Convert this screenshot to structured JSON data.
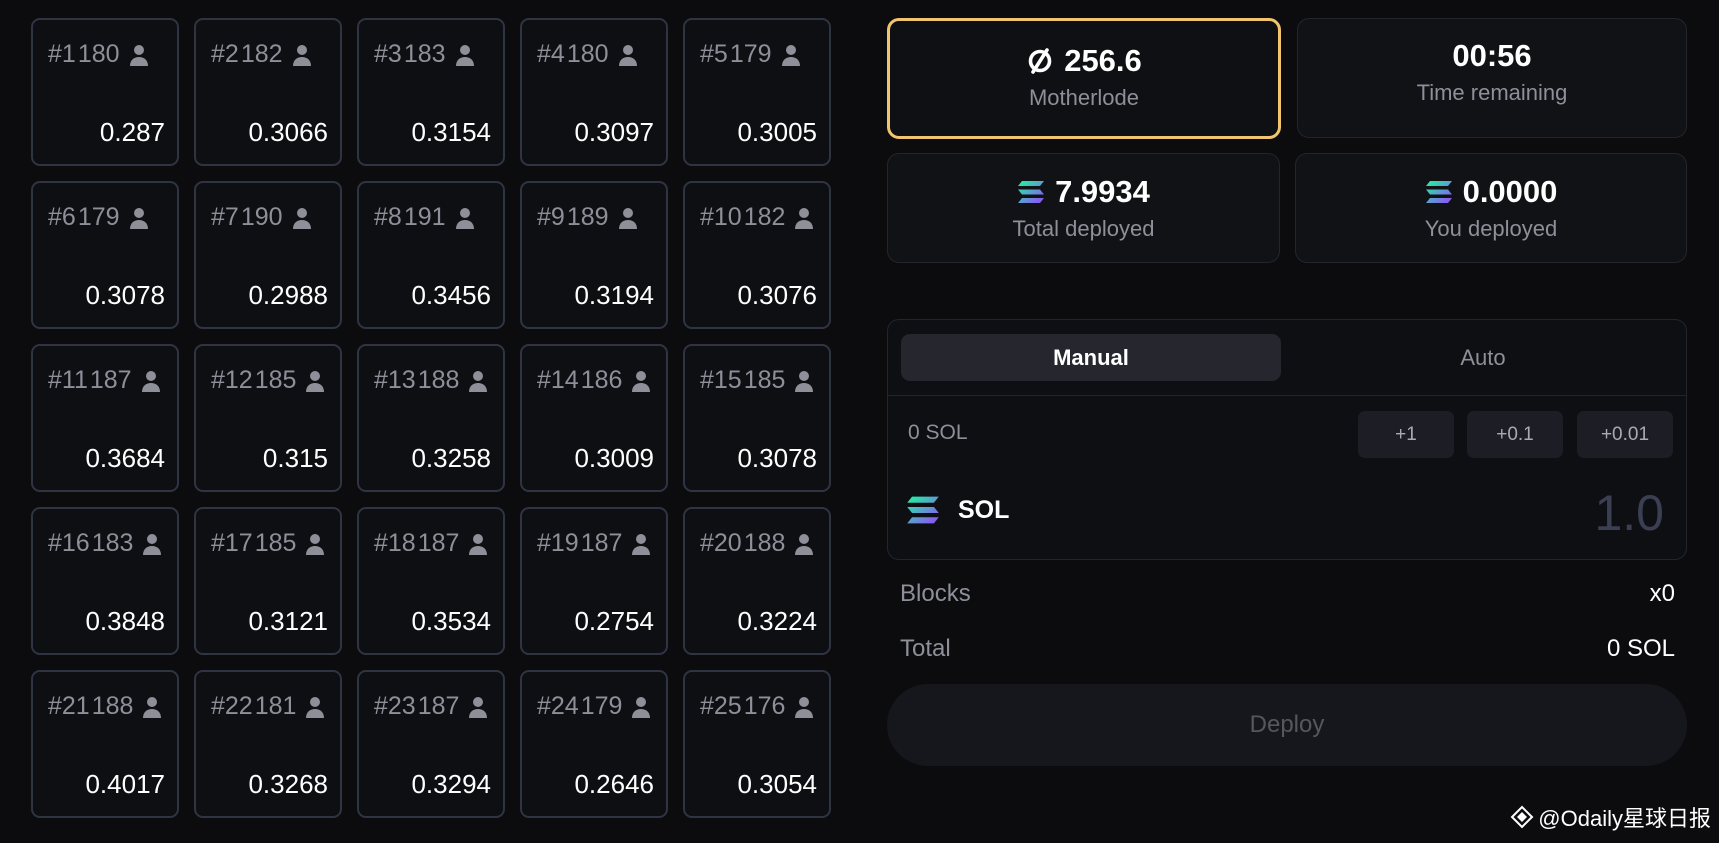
{
  "grid": [
    {
      "id": "#1",
      "count": "180",
      "value": "0.287"
    },
    {
      "id": "#2",
      "count": "182",
      "value": "0.3066"
    },
    {
      "id": "#3",
      "count": "183",
      "value": "0.3154"
    },
    {
      "id": "#4",
      "count": "180",
      "value": "0.3097"
    },
    {
      "id": "#5",
      "count": "179",
      "value": "0.3005"
    },
    {
      "id": "#6",
      "count": "179",
      "value": "0.3078"
    },
    {
      "id": "#7",
      "count": "190",
      "value": "0.2988"
    },
    {
      "id": "#8",
      "count": "191",
      "value": "0.3456"
    },
    {
      "id": "#9",
      "count": "189",
      "value": "0.3194"
    },
    {
      "id": "#10",
      "count": "182",
      "value": "0.3076"
    },
    {
      "id": "#11",
      "count": "187",
      "value": "0.3684"
    },
    {
      "id": "#12",
      "count": "185",
      "value": "0.315"
    },
    {
      "id": "#13",
      "count": "188",
      "value": "0.3258"
    },
    {
      "id": "#14",
      "count": "186",
      "value": "0.3009"
    },
    {
      "id": "#15",
      "count": "185",
      "value": "0.3078"
    },
    {
      "id": "#16",
      "count": "183",
      "value": "0.3848"
    },
    {
      "id": "#17",
      "count": "185",
      "value": "0.3121"
    },
    {
      "id": "#18",
      "count": "187",
      "value": "0.3534"
    },
    {
      "id": "#19",
      "count": "187",
      "value": "0.2754"
    },
    {
      "id": "#20",
      "count": "188",
      "value": "0.3224"
    },
    {
      "id": "#21",
      "count": "188",
      "value": "0.4017"
    },
    {
      "id": "#22",
      "count": "181",
      "value": "0.3268"
    },
    {
      "id": "#23",
      "count": "187",
      "value": "0.3294"
    },
    {
      "id": "#24",
      "count": "179",
      "value": "0.2646"
    },
    {
      "id": "#25",
      "count": "176",
      "value": "0.3054"
    }
  ],
  "motherlode": {
    "value": "256.6",
    "label": "Motherlode",
    "icon": "ore-icon",
    "border_color": "#f2c46d"
  },
  "timer": {
    "value": "00:56",
    "label": "Time remaining"
  },
  "total_deployed": {
    "value": "7.9934",
    "label": "Total deployed",
    "icon": "solana-icon"
  },
  "you_deployed": {
    "value": "0.0000",
    "label": "You deployed",
    "icon": "solana-icon"
  },
  "tabs": {
    "manual": "Manual",
    "auto": "Auto"
  },
  "amount": {
    "label": "0 SOL",
    "quick": [
      "+1",
      "+0.1",
      "+0.01"
    ]
  },
  "sol": {
    "name": "SOL",
    "placeholder": "1.0"
  },
  "summary": {
    "blocks_label": "Blocks",
    "blocks_value": "x0",
    "total_label": "Total",
    "total_value": "0 SOL"
  },
  "deploy_label": "Deploy",
  "watermark": "@Odaily星球日报"
}
